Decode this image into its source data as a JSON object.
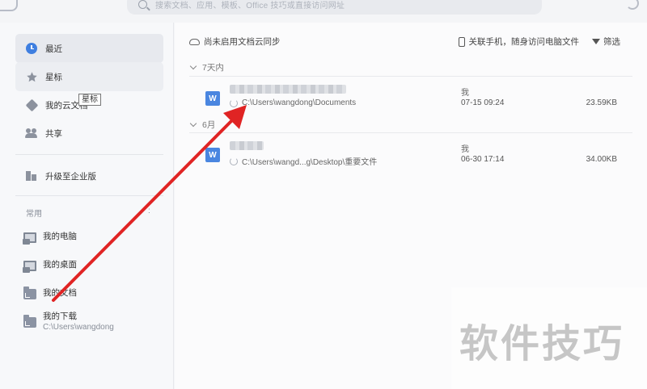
{
  "search": {
    "placeholder": "搜索文档、应用、模板、Office 技巧或直接访问网址"
  },
  "sidebar": {
    "nav": [
      {
        "label": "最近",
        "icon": "clock-icon",
        "active": true
      },
      {
        "label": "星标",
        "icon": "star-icon"
      },
      {
        "label": "我的云文档",
        "icon": "cube-icon"
      },
      {
        "label": "共享",
        "icon": "users-icon"
      },
      {
        "label": "升级至企业版",
        "icon": "building-icon"
      }
    ],
    "tooltip": "星标",
    "section_label": "常用",
    "section_dots": ":",
    "locations": [
      {
        "title": "我的电脑",
        "icon": "computer-icon"
      },
      {
        "title": "我的桌面",
        "icon": "desktop-icon"
      },
      {
        "title": "我的文档",
        "icon": "folder-icon"
      },
      {
        "title": "我的下载",
        "subtitle": "C:\\Users\\wangdong",
        "icon": "download-folder-icon"
      }
    ]
  },
  "toolbar": {
    "sync_label": "尚未启用文档云同步",
    "mobile_label": "关联手机，随身访问电脑文件",
    "filter_label": "筛选"
  },
  "groups": [
    {
      "label": "7天内",
      "files": [
        {
          "icon_letter": "W",
          "path": "C:\\Users\\wangdong\\Documents",
          "owner": "我",
          "time": "07-15 09:24",
          "size": "23.59KB"
        }
      ]
    },
    {
      "label": "6月",
      "files": [
        {
          "icon_letter": "W",
          "path": "C:\\Users\\wangd...g\\Desktop\\重要文件",
          "owner": "我",
          "time": "06-30 17:14",
          "size": "34.00KB"
        }
      ]
    }
  ],
  "watermark": "软件技巧",
  "colors": {
    "accent": "#3f7fe0",
    "arrow": "#e02424",
    "doc_icon": "#4a86e0"
  }
}
